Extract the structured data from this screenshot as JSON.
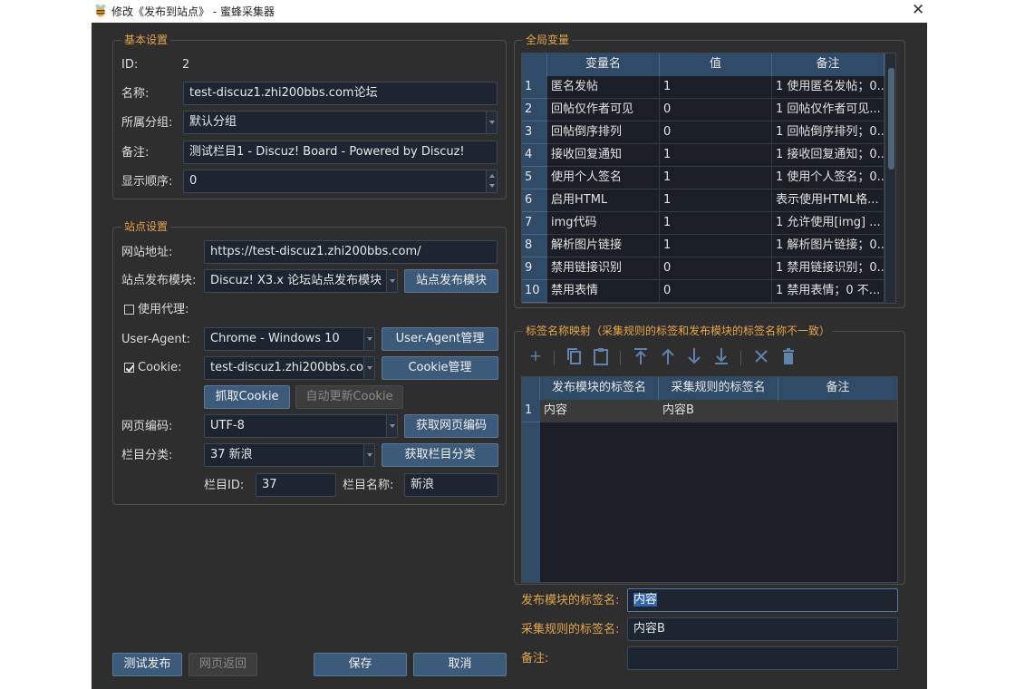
{
  "window": {
    "title": "修改《发布到站点》 - 蜜蜂采集器"
  },
  "basic": {
    "section_title": "基本设置",
    "id_label": "ID:",
    "id_value": "2",
    "name_label": "名称:",
    "name_value": "test-discuz1.zhi200bbs.com论坛",
    "group_label": "所属分组:",
    "group_value": "默认分组",
    "note_label": "备注:",
    "note_value": "测试栏目1 -  Discuz! Board -  Powered by Discuz!",
    "order_label": "显示顺序:",
    "order_value": "0"
  },
  "site": {
    "section_title": "站点设置",
    "url_label": "网站地址:",
    "url_value": "https://test-discuz1.zhi200bbs.com/",
    "module_label": "站点发布模块:",
    "module_value": "Discuz! X3.x 论坛站点发布模块",
    "module_button": "站点发布模块",
    "proxy_label": "使用代理:",
    "ua_label": "User-Agent:",
    "ua_value": "Chrome - Windows 10",
    "ua_button": "User-Agent管理",
    "cookie_label": "Cookie:",
    "cookie_value": "test-discuz1.zhi200bbs.com",
    "cookie_button": "Cookie管理",
    "grab_cookie_button": "抓取Cookie",
    "auto_cookie_button": "自动更新Cookie",
    "encoding_label": "网页编码:",
    "encoding_value": "UTF-8",
    "encoding_button": "获取网页编码",
    "category_label": "栏目分类:",
    "category_value": "37 新浪",
    "category_button": "获取栏目分类",
    "cat_id_label": "栏目ID:",
    "cat_id_value": "37",
    "cat_name_label": "栏目名称:",
    "cat_name_value": "新浪"
  },
  "footer": {
    "test_button": "测试发布",
    "back_button": "网页返回",
    "save_button": "保存",
    "cancel_button": "取消"
  },
  "globals": {
    "section_title": "全局变量",
    "headers": [
      "变量名",
      "值",
      "备注"
    ],
    "rows": [
      {
        "n": "1",
        "name": "匿名发帖",
        "value": "1",
        "note": "1 使用匿名发帖；0..."
      },
      {
        "n": "2",
        "name": "回帖仅作者可见",
        "value": "0",
        "note": "1 回帖仅作者可见..."
      },
      {
        "n": "3",
        "name": "回帖倒序排列",
        "value": "0",
        "note": "1 回帖倒序排列；0..."
      },
      {
        "n": "4",
        "name": "接收回复通知",
        "value": "1",
        "note": "1 接收回复通知；0..."
      },
      {
        "n": "5",
        "name": "使用个人签名",
        "value": "1",
        "note": "1 使用个人签名；0..."
      },
      {
        "n": "6",
        "name": "启用HTML",
        "value": "1",
        "note": "表示使用HTML格..."
      },
      {
        "n": "7",
        "name": "img代码",
        "value": "1",
        "note": "1 允许使用[img] ..."
      },
      {
        "n": "8",
        "name": "解析图片链接",
        "value": "1",
        "note": "1 解析图片链接；0..."
      },
      {
        "n": "9",
        "name": "禁用链接识别",
        "value": "0",
        "note": "1 禁用链接识别；0..."
      },
      {
        "n": "10",
        "name": "禁用表情",
        "value": "0",
        "note": "1 禁用表情；0 不..."
      }
    ]
  },
  "mapping": {
    "section_title": "标签名称映射（采集规则的标签和发布模块的标签名称不一致）",
    "headers": [
      "发布模块的标签名",
      "采集规则的标签名",
      "备注"
    ],
    "rows": [
      {
        "n": "1",
        "module_tag": "内容",
        "rule_tag": "内容B",
        "note": ""
      }
    ],
    "module_tag_label": "发布模块的标签名:",
    "module_tag_value": "内容",
    "rule_tag_label": "采集规则的标签名:",
    "rule_tag_value": "内容B",
    "note_label": "备注:",
    "note_value": ""
  },
  "colors": {
    "accent": "#e3a64a",
    "button": "#3c5a7a",
    "header": "#2f4b68",
    "toolbar_icon": "#5c84ad"
  }
}
